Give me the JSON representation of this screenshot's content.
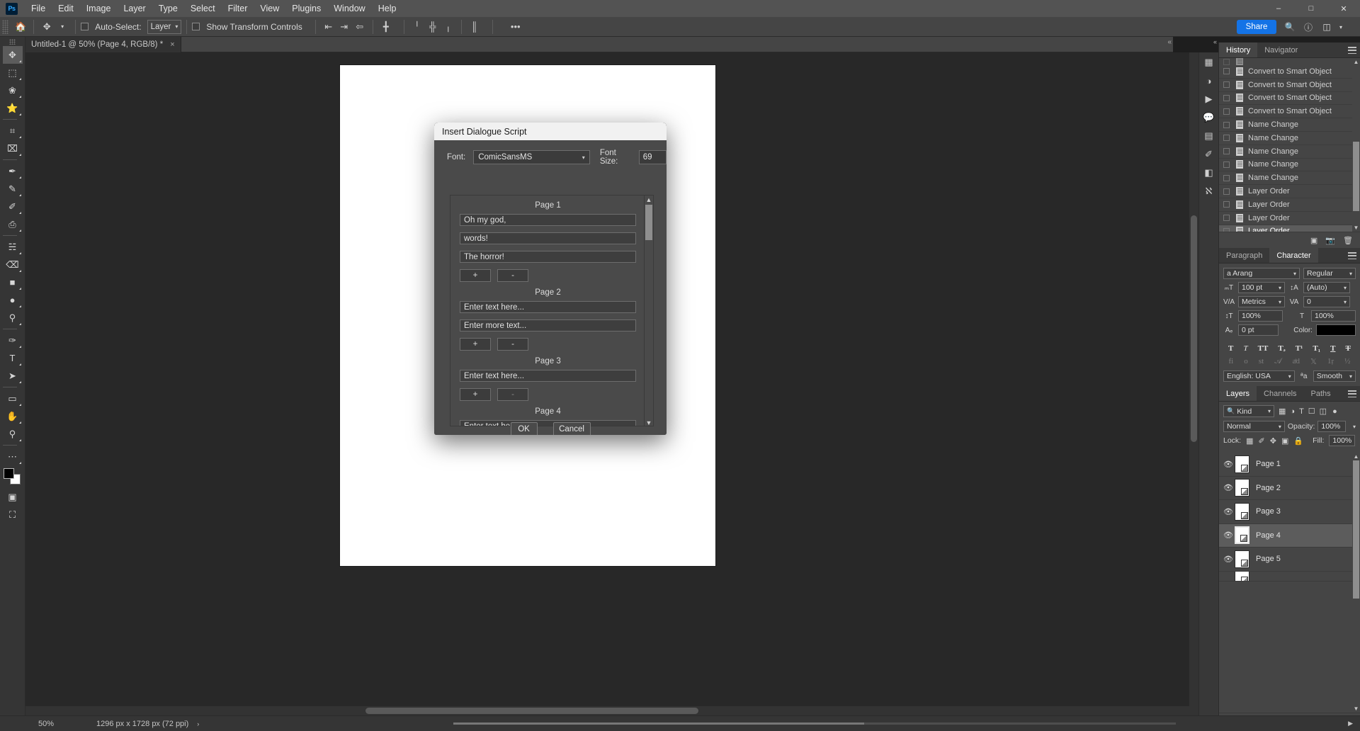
{
  "app": {
    "logo": "Ps",
    "menus": [
      "File",
      "Edit",
      "Image",
      "Layer",
      "Type",
      "Select",
      "Filter",
      "View",
      "Plugins",
      "Window",
      "Help"
    ],
    "window_controls": [
      "minimize",
      "maximize",
      "close"
    ]
  },
  "options_bar": {
    "home_icon": "home-icon",
    "move_tool_icon": "move-tool-icon",
    "auto_select_label": "Auto-Select:",
    "auto_select_checked": false,
    "layer_select_value": "Layer",
    "show_transform_label": "Show Transform Controls",
    "show_transform_checked": false,
    "align_icons": [
      "align-left-icon",
      "align-center-h-icon",
      "align-right-icon",
      "distribute-h-icon",
      "align-top-icon",
      "align-middle-v-icon",
      "align-bottom-icon",
      "distribute-v-icon"
    ],
    "more_label": "•••",
    "share_label": "Share",
    "right_icons": [
      "search-icon",
      "help-icon",
      "workspace-icon"
    ]
  },
  "tabs": {
    "document": "Untitled-1 @ 50% (Page 4, RGB/8) *",
    "close_glyph": "×"
  },
  "toolbar": {
    "tools": [
      {
        "name": "move-tool",
        "glyph": "✥",
        "selected": true
      },
      {
        "name": "marquee-tool",
        "glyph": "⬚",
        "selected": false
      },
      {
        "name": "lasso-tool",
        "glyph": "❀",
        "selected": false
      },
      {
        "name": "object-select-tool",
        "glyph": "⭐",
        "selected": false
      },
      {
        "name": "crop-tool",
        "glyph": "⌗",
        "selected": false
      },
      {
        "name": "frame-tool",
        "glyph": "⌧",
        "selected": false
      },
      {
        "name": "eyedropper-tool",
        "glyph": "✒",
        "selected": false
      },
      {
        "name": "spot-healing-tool",
        "glyph": "✎",
        "selected": false
      },
      {
        "name": "brush-tool",
        "glyph": "✐",
        "selected": false
      },
      {
        "name": "clone-stamp-tool",
        "glyph": "⎙",
        "selected": false
      },
      {
        "name": "history-brush-tool",
        "glyph": "☵",
        "selected": false
      },
      {
        "name": "eraser-tool",
        "glyph": "⌫",
        "selected": false
      },
      {
        "name": "gradient-tool",
        "glyph": "■",
        "selected": false
      },
      {
        "name": "blur-tool",
        "glyph": "●",
        "selected": false
      },
      {
        "name": "dodge-tool",
        "glyph": "⚲",
        "selected": false
      },
      {
        "name": "pen-tool",
        "glyph": "✑",
        "selected": false
      },
      {
        "name": "type-tool",
        "glyph": "T",
        "selected": false
      },
      {
        "name": "path-selection-tool",
        "glyph": "➤",
        "selected": false
      },
      {
        "name": "rectangle-tool",
        "glyph": "▭",
        "selected": false
      },
      {
        "name": "hand-tool",
        "glyph": "✋",
        "selected": false
      },
      {
        "name": "zoom-tool",
        "glyph": "⚲",
        "selected": false
      },
      {
        "name": "more-tools",
        "glyph": "⋯",
        "selected": false
      }
    ],
    "foreground_color": "#000000",
    "background_color": "#ffffff",
    "quick_mask_icon": "quick-mask-icon",
    "screen_mode_icon": "screen-mode-icon"
  },
  "dialog": {
    "title": "Insert Dialogue Script",
    "font_label": "Font:",
    "font_value": "ComicSansMS",
    "font_size_label": "Font Size:",
    "font_size_value": "69",
    "ok_label": "OK",
    "cancel_label": "Cancel",
    "add_label": "+",
    "remove_label": "-",
    "pages": [
      {
        "header": "Page 1",
        "lines": [
          "Oh my god,",
          "words!",
          "The horror!"
        ],
        "remove_enabled": true
      },
      {
        "header": "Page 2",
        "lines": [
          "Enter text here...",
          "Enter more text..."
        ],
        "remove_enabled": true
      },
      {
        "header": "Page 3",
        "lines": [
          "Enter text here..."
        ],
        "remove_enabled": false
      },
      {
        "header": "Page 4",
        "lines": [
          "Enter text here..."
        ],
        "remove_enabled": false
      }
    ]
  },
  "history_panel": {
    "tabs": [
      "History",
      "Navigator"
    ],
    "active_tab": "History",
    "items": [
      {
        "label": "Convert to Smart Object",
        "selected": false
      },
      {
        "label": "Convert to Smart Object",
        "selected": false
      },
      {
        "label": "Convert to Smart Object",
        "selected": false
      },
      {
        "label": "Convert to Smart Object",
        "selected": false
      },
      {
        "label": "Name Change",
        "selected": false
      },
      {
        "label": "Name Change",
        "selected": false
      },
      {
        "label": "Name Change",
        "selected": false
      },
      {
        "label": "Name Change",
        "selected": false
      },
      {
        "label": "Name Change",
        "selected": false
      },
      {
        "label": "Layer Order",
        "selected": false
      },
      {
        "label": "Layer Order",
        "selected": false
      },
      {
        "label": "Layer Order",
        "selected": false
      },
      {
        "label": "Layer Order",
        "selected": true
      }
    ],
    "footer_icons": [
      "create-document-icon",
      "create-snapshot-icon",
      "delete-icon"
    ]
  },
  "character_panel": {
    "tabs": [
      "Paragraph",
      "Character"
    ],
    "active_tab": "Character",
    "font_family": "a Arang",
    "font_style": "Regular",
    "font_size": "100 pt",
    "leading": "(Auto)",
    "kerning": "Metrics",
    "tracking": "0",
    "vertical_scale": "100%",
    "horizontal_scale": "100%",
    "baseline_shift": "0 pt",
    "color_label": "Color:",
    "color_value": "#000000",
    "style_buttons": [
      "bold",
      "italic",
      "all-caps",
      "small-caps",
      "superscript",
      "subscript",
      "underline",
      "strikethrough"
    ],
    "opentype_buttons": [
      "standard-ligatures",
      "discretionary-ligatures",
      "swash",
      "stylistic-alternates",
      "titling-alternates",
      "contextual-alternates",
      "ordinals",
      "fractions"
    ],
    "language": "English: USA",
    "anti_alias_icon": "anti-alias-icon",
    "anti_alias": "Smooth"
  },
  "layers_panel": {
    "tabs": [
      "Layers",
      "Channels",
      "Paths"
    ],
    "active_tab": "Layers",
    "filter_label": "Kind",
    "filter_icons": [
      "pixel-filter-icon",
      "adjustment-filter-icon",
      "type-filter-icon",
      "shape-filter-icon",
      "smart-object-filter-icon"
    ],
    "filter_toggle": "filter-toggle-icon",
    "blend_mode": "Normal",
    "opacity_label": "Opacity:",
    "opacity_value": "100%",
    "lock_label": "Lock:",
    "lock_icons": [
      "lock-transparent-icon",
      "lock-image-icon",
      "lock-position-icon",
      "lock-artboard-icon",
      "lock-all-icon"
    ],
    "fill_label": "Fill:",
    "fill_value": "100%",
    "layers": [
      {
        "name": "Page 1",
        "visible": true,
        "selected": false
      },
      {
        "name": "Page 2",
        "visible": true,
        "selected": false
      },
      {
        "name": "Page 3",
        "visible": true,
        "selected": false
      },
      {
        "name": "Page 4",
        "visible": true,
        "selected": true
      },
      {
        "name": "Page 5",
        "visible": true,
        "selected": false
      }
    ],
    "footer_icons": [
      "link-layers-icon",
      "layer-style-fx-icon",
      "layer-mask-icon",
      "adjustment-layer-icon",
      "new-group-icon",
      "new-layer-icon",
      "delete-layer-icon"
    ]
  },
  "status_bar": {
    "zoom": "50%",
    "document_size": "1296 px x 1728 px (72 ppi)",
    "arrow_glyph": "›"
  }
}
